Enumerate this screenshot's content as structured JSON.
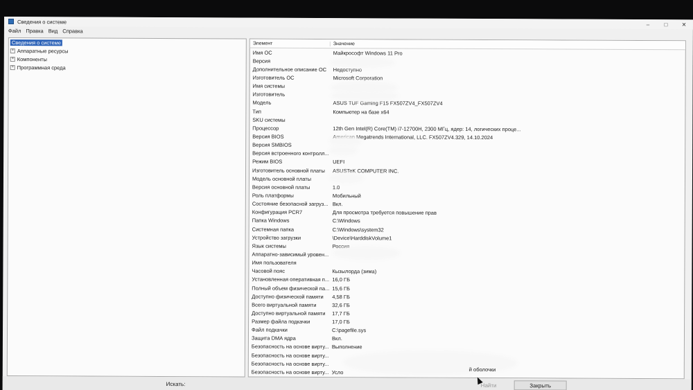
{
  "window": {
    "title": "Сведения о системе",
    "icon": "system-info-icon"
  },
  "menu": [
    "Файл",
    "Правка",
    "Вид",
    "Справка"
  ],
  "tree": [
    {
      "label": "Сведения о системе",
      "selected": true
    },
    {
      "label": "Аппаратные ресурсы"
    },
    {
      "label": "Компоненты"
    },
    {
      "label": "Программная среда"
    }
  ],
  "details": {
    "header": {
      "name": "Элемент",
      "value": "Значение"
    },
    "rows": [
      {
        "name": "Имя ОС",
        "value": "Майкрософт Windows 11 Pro"
      },
      {
        "name": "Версия",
        "value": ""
      },
      {
        "name": "Дополнительное описание ОС",
        "value": "Недоступно"
      },
      {
        "name": "Изготовитель ОС",
        "value": "Microsoft Corporation"
      },
      {
        "name": "Имя системы",
        "value": ""
      },
      {
        "name": "Изготовитель",
        "value": ""
      },
      {
        "name": "Модель",
        "value": "ASUS TUF Gaming F15 FX507ZV4_FX507ZV4"
      },
      {
        "name": "Тип",
        "value": "Компьютер на базе x64"
      },
      {
        "name": "SKU системы",
        "value": ""
      },
      {
        "name": "Процессор",
        "value": "12th Gen Intel(R) Core(TM) i7-12700H, 2300 МГц, ядер: 14, логических проце..."
      },
      {
        "name": "Версия BIOS",
        "value": "American Megatrends International, LLC. FX507ZV4.329, 14.10.2024"
      },
      {
        "name": "Версия SMBIOS",
        "value": ""
      },
      {
        "name": "Версия встроенного контролл...",
        "value": ""
      },
      {
        "name": "Режим BIOS",
        "value": "UEFI"
      },
      {
        "name": "Изготовитель основной платы",
        "value": "ASUSTeK COMPUTER INC."
      },
      {
        "name": "Модель основной платы",
        "value": ""
      },
      {
        "name": "Версия основной платы",
        "value": "1.0"
      },
      {
        "name": "Роль платформы",
        "value": "Мобильный"
      },
      {
        "name": "Состояние безопасной загруз...",
        "value": "Вкл."
      },
      {
        "name": "Конфигурация PCR7",
        "value": "Для просмотра требуется повышение прав"
      },
      {
        "name": "Папка Windows",
        "value": "C:\\Windows"
      },
      {
        "name": "Системная папка",
        "value": "C:\\Windows\\system32"
      },
      {
        "name": "Устройство загрузки",
        "value": "\\Device\\HarddiskVolume1"
      },
      {
        "name": "Язык системы",
        "value": "Россия"
      },
      {
        "name": "Аппаратно-зависимый уровен...",
        "value": ""
      },
      {
        "name": "Имя пользователя",
        "value": ""
      },
      {
        "name": "Часовой пояс",
        "value": "Кызылорда (зима)"
      },
      {
        "name": "Установленная оперативная п...",
        "value": "16,0 ГБ"
      },
      {
        "name": "Полный объем физической па...",
        "value": "15,6 ГБ"
      },
      {
        "name": "Доступно физической памяти",
        "value": "4,58 ГБ"
      },
      {
        "name": "Всего виртуальной памяти",
        "value": "32,6 ГБ"
      },
      {
        "name": "Доступно виртуальной памяти",
        "value": "17,7 ГБ"
      },
      {
        "name": "Размер файла подкачки",
        "value": "17,0 ГБ"
      },
      {
        "name": "Файл подкачки",
        "value": "C:\\pagefile.sys"
      },
      {
        "name": "Защита DMA ядра",
        "value": "Вкл."
      },
      {
        "name": "Безопасность на основе вирту...",
        "value": "Выполнение"
      },
      {
        "name": "Безопасность на основе вирту...",
        "value": ""
      },
      {
        "name": "Безопасность на основе вирту...",
        "value": ""
      },
      {
        "name": "Безопасность на основе вирту...",
        "value": "Усло"
      }
    ]
  },
  "partial_text": "й оболочки",
  "footer": {
    "find_label": "Искать:",
    "find_button": "Найти",
    "close_button": "Закрыть"
  }
}
